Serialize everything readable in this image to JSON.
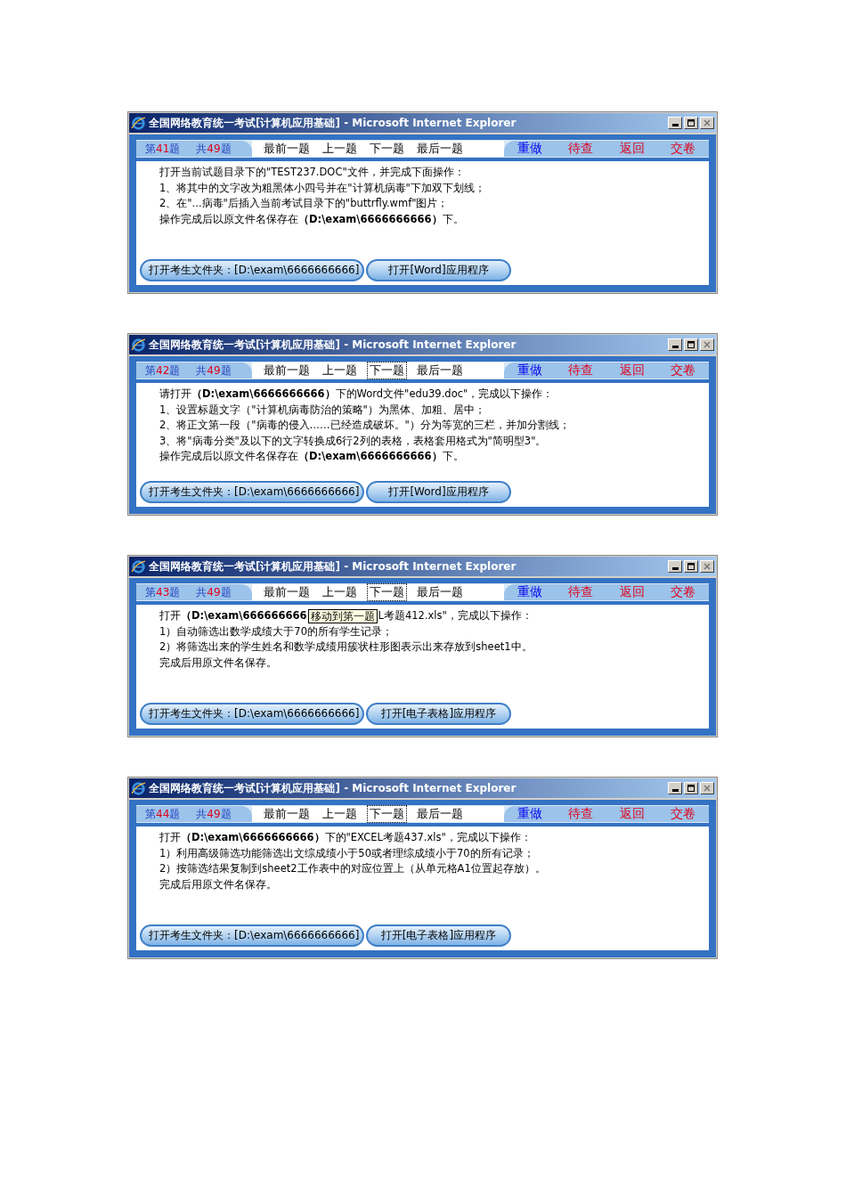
{
  "windows": [
    {
      "title": "全国网络教育统一考试[计算机应用基础] - Microsoft Internet Explorer",
      "counters": [
        {
          "parts": [
            "第",
            "41",
            "题"
          ]
        },
        {
          "parts": [
            "共",
            "49",
            "题"
          ]
        }
      ],
      "nav": [
        {
          "label": "最前一题",
          "focused": false
        },
        {
          "label": "上一题",
          "focused": false
        },
        {
          "label": "下一题",
          "focused": false
        },
        {
          "label": "最后一题",
          "focused": false
        }
      ],
      "actions": [
        {
          "label": "重做",
          "warning": false
        },
        {
          "label": "待查",
          "warning": true
        },
        {
          "label": "返回",
          "warning": true
        },
        {
          "label": "交卷",
          "warning": true
        }
      ],
      "lines": [
        {
          "parts": [
            "打开当前试题目录下的\"TEST237.DOC\"文件，并完成下面操作："
          ]
        },
        {
          "parts": [
            "1、将其中的文字改为粗黑体小四号并在\"计算机病毒\"下加双下划线；"
          ]
        },
        {
          "parts": [
            "2、在\"...病毒\"后插入当前考试目录下的\"buttrfly.wmf\"图片；"
          ]
        },
        {
          "parts": [
            "操作完成后以原文件名保存在**（D:\\exam\\6666666666）**下。"
          ]
        }
      ],
      "buttons": [
        "打开考生文件夹：[D:\\exam\\6666666666]",
        "打开[Word]应用程序"
      ]
    },
    {
      "title": "全国网络教育统一考试[计算机应用基础] - Microsoft Internet Explorer",
      "counters": [
        {
          "parts": [
            "第",
            "42",
            "题"
          ]
        },
        {
          "parts": [
            "共",
            "49",
            "题"
          ]
        }
      ],
      "nav": [
        {
          "label": "最前一题",
          "focused": false
        },
        {
          "label": "上一题",
          "focused": false
        },
        {
          "label": "下一题",
          "focused": true
        },
        {
          "label": "最后一题",
          "focused": false
        }
      ],
      "actions": [
        {
          "label": "重做",
          "warning": false
        },
        {
          "label": "待查",
          "warning": true
        },
        {
          "label": "返回",
          "warning": true
        },
        {
          "label": "交卷",
          "warning": true
        }
      ],
      "lines": [
        {
          "parts": [
            "请打开**（D:\\exam\\6666666666）**下的Word文件\"edu39.doc\"，完成以下操作："
          ]
        },
        {
          "parts": [
            "1、设置标题文字（\"计算机病毒防治的策略\"）为黑体、加粗、居中；"
          ]
        },
        {
          "parts": [
            "2、将正文第一段（\"病毒的侵入……已经造成破坏。\"）分为等宽的三栏，并加分割线；"
          ]
        },
        {
          "parts": [
            "3、将\"病毒分类\"及以下的文字转换成6行2列的表格，表格套用格式为\"简明型3\"。"
          ]
        },
        {
          "parts": [
            "操作完成后以原文件名保存在**（D:\\exam\\6666666666）**下。"
          ]
        }
      ],
      "buttons": [
        "打开考生文件夹：[D:\\exam\\6666666666]",
        "打开[Word]应用程序"
      ]
    },
    {
      "title": "全国网络教育统一考试[计算机应用基础] - Microsoft Internet Explorer",
      "counters": [
        {
          "parts": [
            "第",
            "43",
            "题"
          ]
        },
        {
          "parts": [
            "共",
            "49",
            "题"
          ]
        }
      ],
      "nav": [
        {
          "label": "最前一题",
          "focused": false
        },
        {
          "label": "上一题",
          "focused": false
        },
        {
          "label": "下一题",
          "focused": true
        },
        {
          "label": "最后一题",
          "focused": false
        }
      ],
      "actions": [
        {
          "label": "重做",
          "warning": false
        },
        {
          "label": "待查",
          "warning": true
        },
        {
          "label": "返回",
          "warning": true
        },
        {
          "label": "交卷",
          "warning": true
        }
      ],
      "tooltip": "移动到第一题",
      "lines": [
        {
          "parts": [
            "打开**（D:\\exam\\666666666**",
            "L考题412.xls\"，完成以下操作："
          ]
        },
        {
          "parts": [
            "1）自动筛选出数学成绩大于70的所有学生记录；"
          ]
        },
        {
          "parts": [
            "2）将筛选出来的学生姓名和数学成绩用簇状柱形图表示出来存放到sheet1中。"
          ]
        },
        {
          "parts": [
            "完成后用原文件名保存。"
          ]
        }
      ],
      "buttons": [
        "打开考生文件夹：[D:\\exam\\6666666666]",
        "打开[电子表格]应用程序"
      ]
    },
    {
      "title": "全国网络教育统一考试[计算机应用基础] - Microsoft Internet Explorer",
      "counters": [
        {
          "parts": [
            "第",
            "44",
            "题"
          ]
        },
        {
          "parts": [
            "共",
            "49",
            "题"
          ]
        }
      ],
      "nav": [
        {
          "label": "最前一题",
          "focused": false
        },
        {
          "label": "上一题",
          "focused": false
        },
        {
          "label": "下一题",
          "focused": true
        },
        {
          "label": "最后一题",
          "focused": false
        }
      ],
      "actions": [
        {
          "label": "重做",
          "warning": false
        },
        {
          "label": "待查",
          "warning": true
        },
        {
          "label": "返回",
          "warning": true
        },
        {
          "label": "交卷",
          "warning": true
        }
      ],
      "lines": [
        {
          "parts": [
            "打开**（D:\\exam\\6666666666）**下的\"EXCEL考题437.xls\"，完成以下操作："
          ]
        },
        {
          "parts": [
            "1）利用高级筛选功能筛选出文综成绩小于50或者理综成绩小于70的所有记录；"
          ]
        },
        {
          "parts": [
            "2）按筛选结果复制到sheet2工作表中的对应位置上（从单元格A1位置起存放）。"
          ]
        },
        {
          "parts": [
            "完成后用原文件名保存。"
          ]
        }
      ],
      "buttons": [
        "打开考生文件夹：[D:\\exam\\6666666666]",
        "打开[电子表格]应用程序"
      ]
    }
  ]
}
